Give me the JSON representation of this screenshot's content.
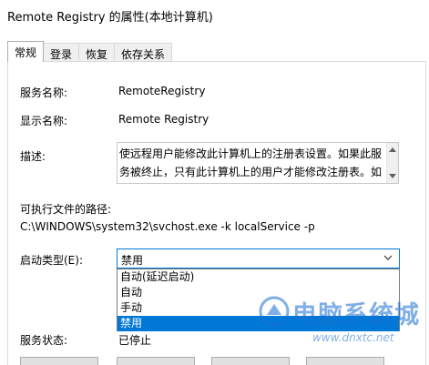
{
  "window": {
    "title": "Remote Registry 的属性(本地计算机)"
  },
  "tabs": [
    {
      "label": "常规",
      "active": true
    },
    {
      "label": "登录",
      "active": false
    },
    {
      "label": "恢复",
      "active": false
    },
    {
      "label": "依存关系",
      "active": false
    }
  ],
  "general": {
    "service_name_label": "服务名称:",
    "service_name_value": "RemoteRegistry",
    "display_name_label": "显示名称:",
    "display_name_value": "Remote Registry",
    "description_label": "描述:",
    "description_value": "使远程用户能修改此计算机上的注册表设置。如果此服务被终止，只有此计算机上的用户才能修改注册表。如",
    "exec_path_label": "可执行文件的路径:",
    "exec_path_value": "C:\\WINDOWS\\system32\\svchost.exe -k localService -p",
    "startup_type_label": "启动类型(E):",
    "startup_type_value": "禁用",
    "startup_options": [
      "自动(延迟启动)",
      "自动",
      "手动",
      "禁用"
    ],
    "selected_option": "禁用",
    "service_status_label": "服务状态:",
    "service_status_value": "已停止"
  },
  "watermark": {
    "text": "电脑系统城",
    "url": "www.dnxtc.net"
  },
  "colors": {
    "accent": "#0078d7",
    "watermark": "#1a6fd0"
  }
}
